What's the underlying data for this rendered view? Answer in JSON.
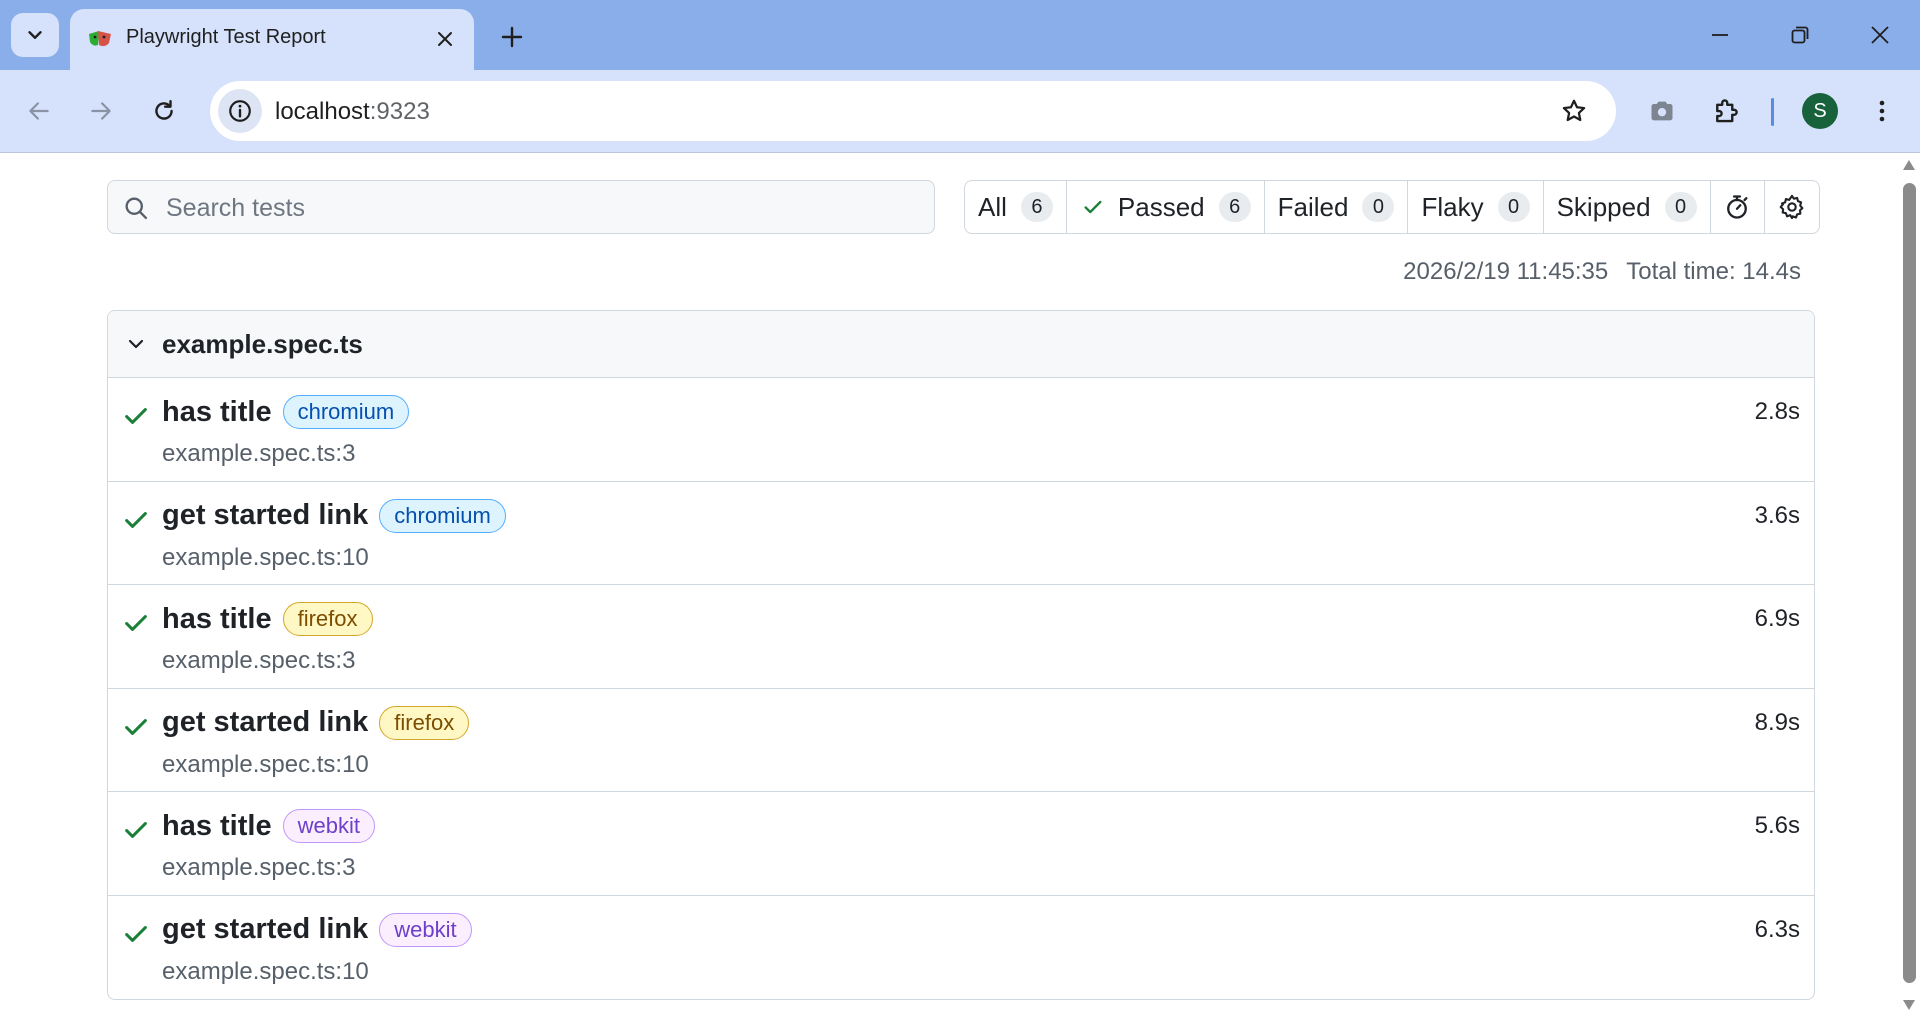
{
  "browser": {
    "tab": {
      "title": "Playwright Test Report",
      "favicon": "playwright-icon"
    },
    "url": {
      "host": "localhost",
      "port": ":9323"
    },
    "profile_initial": "S",
    "accent": "#8aaee9"
  },
  "report": {
    "search": {
      "placeholder": "Search tests",
      "value": ""
    },
    "filters": [
      {
        "label": "All",
        "count": "6"
      },
      {
        "label": "Passed",
        "count": "6"
      },
      {
        "label": "Failed",
        "count": "0"
      },
      {
        "label": "Flaky",
        "count": "0"
      },
      {
        "label": "Skipped",
        "count": "0"
      }
    ],
    "timestamp": "2026/2/19 11:45:35",
    "total_time": "Total time: 14.4s",
    "suite": {
      "name": "example.spec.ts",
      "tests": [
        {
          "title": "has title",
          "project": "chromium",
          "location": "example.spec.ts:3",
          "duration": "2.8s",
          "status": "passed"
        },
        {
          "title": "get started link",
          "project": "chromium",
          "location": "example.spec.ts:10",
          "duration": "3.6s",
          "status": "passed"
        },
        {
          "title": "has title",
          "project": "firefox",
          "location": "example.spec.ts:3",
          "duration": "6.9s",
          "status": "passed"
        },
        {
          "title": "get started link",
          "project": "firefox",
          "location": "example.spec.ts:10",
          "duration": "8.9s",
          "status": "passed"
        },
        {
          "title": "has title",
          "project": "webkit",
          "location": "example.spec.ts:3",
          "duration": "5.6s",
          "status": "passed"
        },
        {
          "title": "get started link",
          "project": "webkit",
          "location": "example.spec.ts:10",
          "duration": "6.3s",
          "status": "passed"
        }
      ]
    },
    "colors": {
      "passed": "#1a7f37",
      "chromium": "#0550ae",
      "firefox": "#7d4e00",
      "webkit": "#6e40c9"
    }
  }
}
